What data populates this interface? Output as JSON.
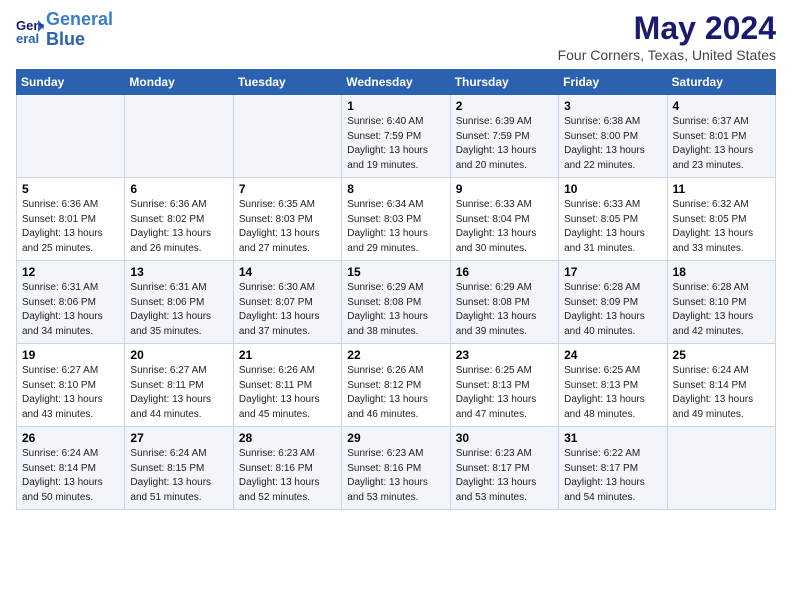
{
  "logo": {
    "line1": "General",
    "line2": "Blue"
  },
  "title": "May 2024",
  "subtitle": "Four Corners, Texas, United States",
  "days_header": [
    "Sunday",
    "Monday",
    "Tuesday",
    "Wednesday",
    "Thursday",
    "Friday",
    "Saturday"
  ],
  "weeks": [
    [
      {
        "day": "",
        "info": ""
      },
      {
        "day": "",
        "info": ""
      },
      {
        "day": "",
        "info": ""
      },
      {
        "day": "1",
        "info": "Sunrise: 6:40 AM\nSunset: 7:59 PM\nDaylight: 13 hours\nand 19 minutes."
      },
      {
        "day": "2",
        "info": "Sunrise: 6:39 AM\nSunset: 7:59 PM\nDaylight: 13 hours\nand 20 minutes."
      },
      {
        "day": "3",
        "info": "Sunrise: 6:38 AM\nSunset: 8:00 PM\nDaylight: 13 hours\nand 22 minutes."
      },
      {
        "day": "4",
        "info": "Sunrise: 6:37 AM\nSunset: 8:01 PM\nDaylight: 13 hours\nand 23 minutes."
      }
    ],
    [
      {
        "day": "5",
        "info": "Sunrise: 6:36 AM\nSunset: 8:01 PM\nDaylight: 13 hours\nand 25 minutes."
      },
      {
        "day": "6",
        "info": "Sunrise: 6:36 AM\nSunset: 8:02 PM\nDaylight: 13 hours\nand 26 minutes."
      },
      {
        "day": "7",
        "info": "Sunrise: 6:35 AM\nSunset: 8:03 PM\nDaylight: 13 hours\nand 27 minutes."
      },
      {
        "day": "8",
        "info": "Sunrise: 6:34 AM\nSunset: 8:03 PM\nDaylight: 13 hours\nand 29 minutes."
      },
      {
        "day": "9",
        "info": "Sunrise: 6:33 AM\nSunset: 8:04 PM\nDaylight: 13 hours\nand 30 minutes."
      },
      {
        "day": "10",
        "info": "Sunrise: 6:33 AM\nSunset: 8:05 PM\nDaylight: 13 hours\nand 31 minutes."
      },
      {
        "day": "11",
        "info": "Sunrise: 6:32 AM\nSunset: 8:05 PM\nDaylight: 13 hours\nand 33 minutes."
      }
    ],
    [
      {
        "day": "12",
        "info": "Sunrise: 6:31 AM\nSunset: 8:06 PM\nDaylight: 13 hours\nand 34 minutes."
      },
      {
        "day": "13",
        "info": "Sunrise: 6:31 AM\nSunset: 8:06 PM\nDaylight: 13 hours\nand 35 minutes."
      },
      {
        "day": "14",
        "info": "Sunrise: 6:30 AM\nSunset: 8:07 PM\nDaylight: 13 hours\nand 37 minutes."
      },
      {
        "day": "15",
        "info": "Sunrise: 6:29 AM\nSunset: 8:08 PM\nDaylight: 13 hours\nand 38 minutes."
      },
      {
        "day": "16",
        "info": "Sunrise: 6:29 AM\nSunset: 8:08 PM\nDaylight: 13 hours\nand 39 minutes."
      },
      {
        "day": "17",
        "info": "Sunrise: 6:28 AM\nSunset: 8:09 PM\nDaylight: 13 hours\nand 40 minutes."
      },
      {
        "day": "18",
        "info": "Sunrise: 6:28 AM\nSunset: 8:10 PM\nDaylight: 13 hours\nand 42 minutes."
      }
    ],
    [
      {
        "day": "19",
        "info": "Sunrise: 6:27 AM\nSunset: 8:10 PM\nDaylight: 13 hours\nand 43 minutes."
      },
      {
        "day": "20",
        "info": "Sunrise: 6:27 AM\nSunset: 8:11 PM\nDaylight: 13 hours\nand 44 minutes."
      },
      {
        "day": "21",
        "info": "Sunrise: 6:26 AM\nSunset: 8:11 PM\nDaylight: 13 hours\nand 45 minutes."
      },
      {
        "day": "22",
        "info": "Sunrise: 6:26 AM\nSunset: 8:12 PM\nDaylight: 13 hours\nand 46 minutes."
      },
      {
        "day": "23",
        "info": "Sunrise: 6:25 AM\nSunset: 8:13 PM\nDaylight: 13 hours\nand 47 minutes."
      },
      {
        "day": "24",
        "info": "Sunrise: 6:25 AM\nSunset: 8:13 PM\nDaylight: 13 hours\nand 48 minutes."
      },
      {
        "day": "25",
        "info": "Sunrise: 6:24 AM\nSunset: 8:14 PM\nDaylight: 13 hours\nand 49 minutes."
      }
    ],
    [
      {
        "day": "26",
        "info": "Sunrise: 6:24 AM\nSunset: 8:14 PM\nDaylight: 13 hours\nand 50 minutes."
      },
      {
        "day": "27",
        "info": "Sunrise: 6:24 AM\nSunset: 8:15 PM\nDaylight: 13 hours\nand 51 minutes."
      },
      {
        "day": "28",
        "info": "Sunrise: 6:23 AM\nSunset: 8:16 PM\nDaylight: 13 hours\nand 52 minutes."
      },
      {
        "day": "29",
        "info": "Sunrise: 6:23 AM\nSunset: 8:16 PM\nDaylight: 13 hours\nand 53 minutes."
      },
      {
        "day": "30",
        "info": "Sunrise: 6:23 AM\nSunset: 8:17 PM\nDaylight: 13 hours\nand 53 minutes."
      },
      {
        "day": "31",
        "info": "Sunrise: 6:22 AM\nSunset: 8:17 PM\nDaylight: 13 hours\nand 54 minutes."
      },
      {
        "day": "",
        "info": ""
      }
    ]
  ]
}
